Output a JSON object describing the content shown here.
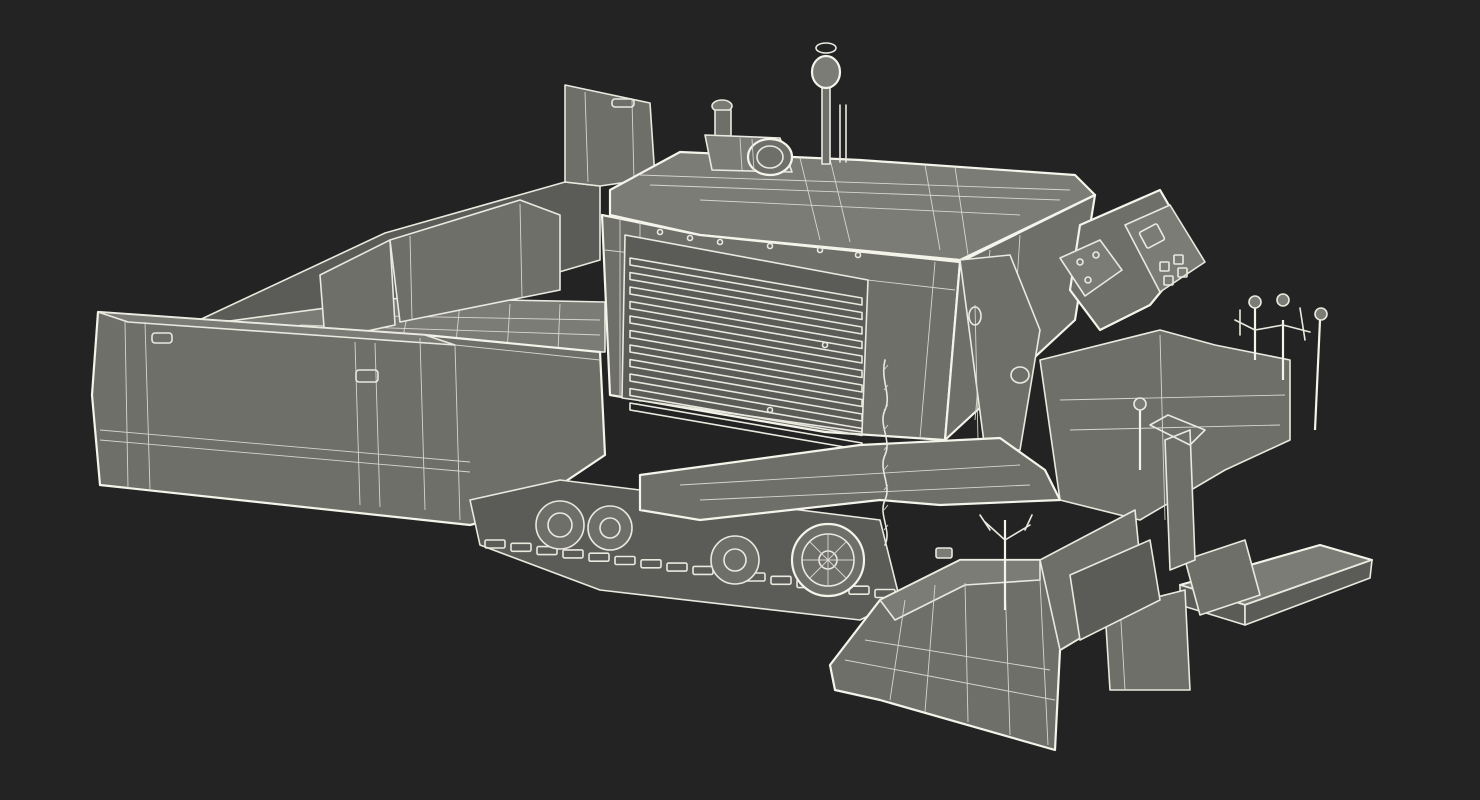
{
  "scene": {
    "subject": "asphalt-paver-wireframe",
    "colors": {
      "background": "#232323",
      "surface": "#6f6f6a",
      "wireframe": "#e9e9df"
    }
  }
}
